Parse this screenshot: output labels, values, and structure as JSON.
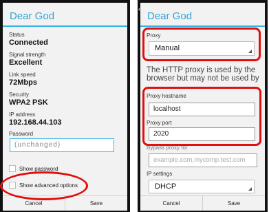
{
  "left_dialog": {
    "title": "Dear God",
    "rows": [
      {
        "label": "Status",
        "value": "Connected"
      },
      {
        "label": "Signal strength",
        "value": "Excellent"
      },
      {
        "label": "Link speed",
        "value": "72Mbps"
      },
      {
        "label": "Security",
        "value": "WPA2 PSK"
      },
      {
        "label": "IP address",
        "value": "192.168.44.103"
      }
    ],
    "password_label": "Password",
    "password_value": "(unchanged)",
    "show_password_label": "Show password",
    "show_advanced_label": "Show advanced options",
    "cancel_label": "Cancel",
    "save_label": "Save"
  },
  "right_dialog": {
    "title": "Dear God",
    "proxy_label": "Proxy",
    "proxy_value": "Manual",
    "proxy_info": "The HTTP proxy is used by the browser but may not be used by the other apps.",
    "hostname_label": "Proxy hostname",
    "hostname_value": "localhost",
    "port_label": "Proxy port",
    "port_value": "2020",
    "bypass_label": "Bypass proxy for",
    "bypass_placeholder": "example.com,mycomp.test.com",
    "ip_settings_label": "IP settings",
    "ip_settings_value": "DHCP",
    "cancel_label": "Cancel",
    "save_label": "Save"
  },
  "colors": {
    "accent": "#33b5e5",
    "highlight": "#e01010"
  }
}
